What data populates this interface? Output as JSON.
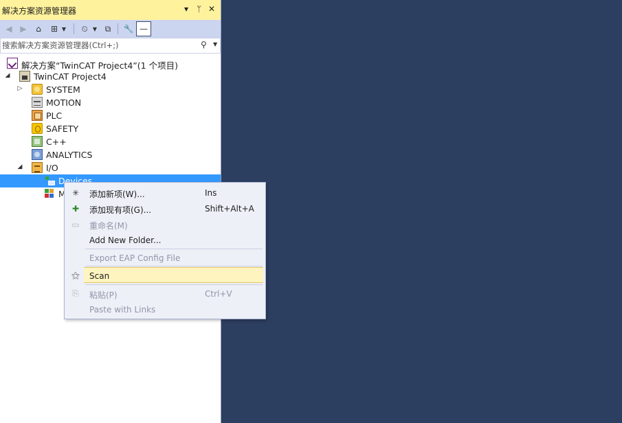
{
  "panel": {
    "title": "解决方案资源管理器",
    "title_buttons": [
      "▾",
      "ᛘ",
      "✕"
    ],
    "search_placeholder": "搜索解决方案资源管理器(Ctrl+;)"
  },
  "tree": {
    "solution": "解决方案“TwinCAT Project4”(1 个项目)",
    "project": "TwinCAT Project4",
    "system": "SYSTEM",
    "motion": "MOTION",
    "plc": "PLC",
    "safety": "SAFETY",
    "cpp": "C++",
    "analytics": "ANALYTICS",
    "io": "I/O",
    "devices": "Devices",
    "mappings": "M"
  },
  "context_menu": {
    "add_new": {
      "label": "添加新项(W)...",
      "shortcut": "Ins"
    },
    "add_existing": {
      "label": "添加现有项(G)...",
      "shortcut": "Shift+Alt+A"
    },
    "rename": {
      "label": "重命名(M)"
    },
    "add_folder": {
      "label": "Add New Folder..."
    },
    "export_eap": {
      "label": "Export EAP Config File"
    },
    "scan": {
      "label": "Scan"
    },
    "paste": {
      "label": "粘贴(P)",
      "shortcut": "Ctrl+V"
    },
    "paste_links": {
      "label": "Paste with Links"
    }
  },
  "colors": {
    "background": "#2d3f60",
    "title_bar": "#fff29d",
    "toolbar": "#ccd5f0",
    "selection": "#3399ff",
    "menu_highlight": "#fdf4bf"
  }
}
